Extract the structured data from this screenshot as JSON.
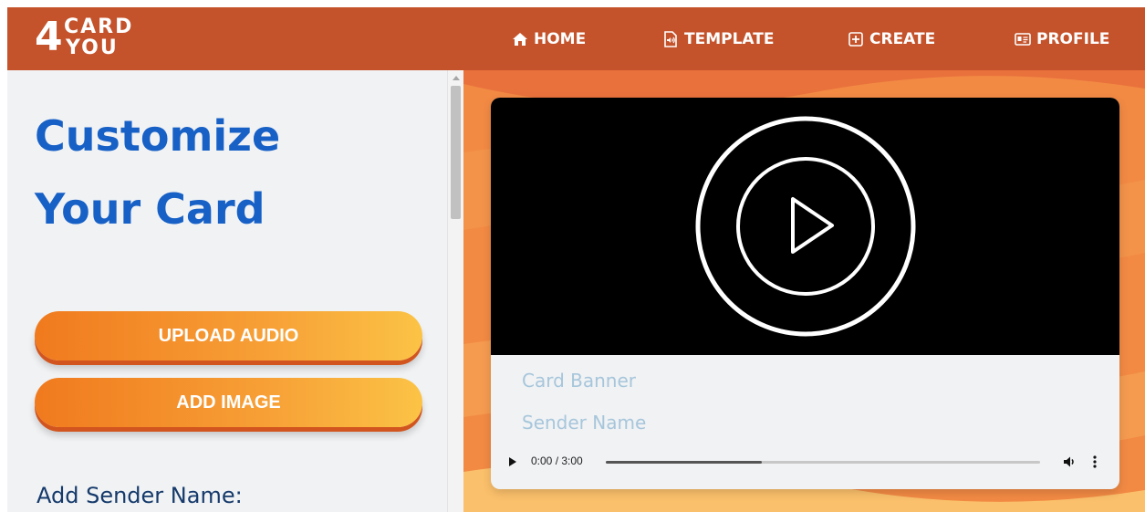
{
  "logo": {
    "number": "4",
    "line1": "CARD",
    "line2": "YOU"
  },
  "nav": {
    "home": "HOME",
    "template": "TEMPLATE",
    "create": "CREATE",
    "profile": "PROFILE"
  },
  "editor": {
    "title_line1": "Customize",
    "title_line2": "Your Card",
    "upload_audio": "UPLOAD AUDIO",
    "add_image": "ADD IMAGE",
    "sender_label": "Add Sender Name:"
  },
  "preview": {
    "card_banner": "Card Banner",
    "sender_name": "Sender Name",
    "audio": {
      "time": "0:00 / 3:00",
      "progress": 0.36
    }
  },
  "colors": {
    "navbar": "#c4532c",
    "title": "#1760c6",
    "button_start": "#f07a1e",
    "button_end": "#fbc346",
    "placeholder_text": "#a7c6db",
    "background_orange": "#f28a44"
  }
}
